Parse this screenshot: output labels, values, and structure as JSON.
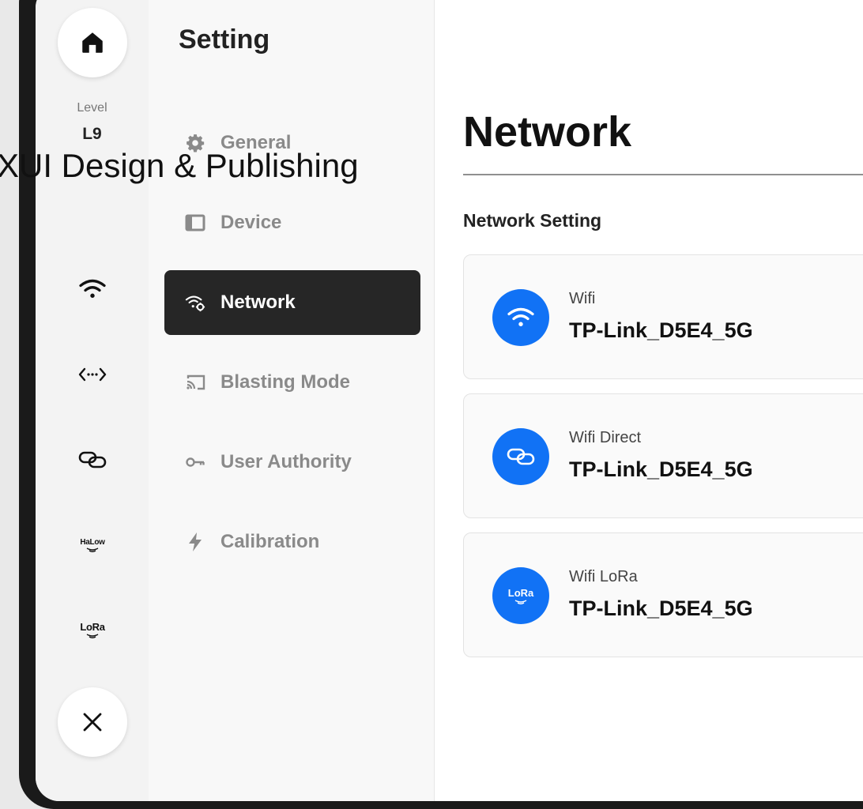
{
  "rail": {
    "level_label": "Level",
    "level_value": "L9",
    "halow_label": "HaLow",
    "lora_label": "LoRa"
  },
  "menu": {
    "title": "Setting",
    "items": [
      {
        "label": "General",
        "icon": "gear-icon"
      },
      {
        "label": "Device",
        "icon": "device-icon"
      },
      {
        "label": "Network",
        "icon": "network-icon",
        "active": true
      },
      {
        "label": "Blasting Mode",
        "icon": "cast-icon"
      },
      {
        "label": "User Authority",
        "icon": "key-icon"
      },
      {
        "label": "Calibration",
        "icon": "bolt-icon"
      }
    ]
  },
  "main": {
    "title": "Network",
    "section": "Network Setting",
    "cards": [
      {
        "label": "Wifi",
        "value": "TP-Link_D5E4_5G",
        "icon": "wifi-icon"
      },
      {
        "label": "Wifi Direct",
        "value": "TP-Link_D5E4_5G",
        "icon": "link-icon"
      },
      {
        "label": "Wifi LoRa",
        "value": "TP-Link_D5E4_5G",
        "icon": "lora-icon",
        "icon_text": "LoRa"
      }
    ]
  },
  "watermark": "XUI Design & Publishing",
  "colors": {
    "accent": "#1172f5",
    "active_item": "#262626"
  }
}
